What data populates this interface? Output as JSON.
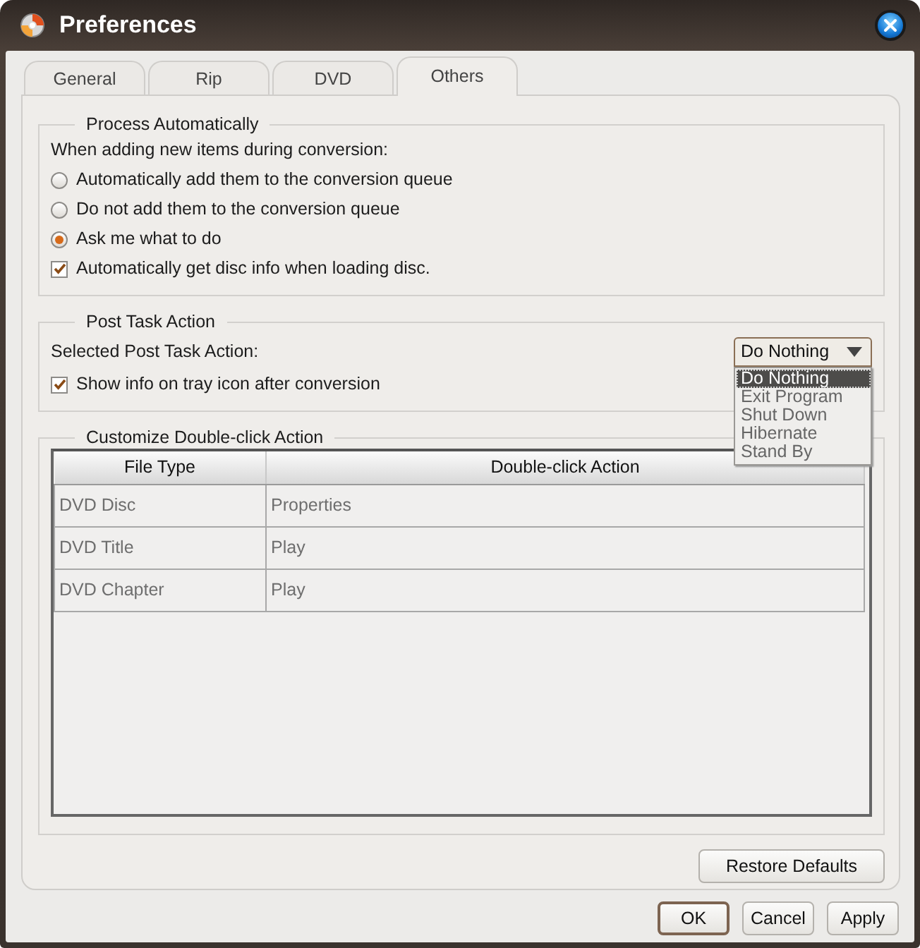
{
  "window": {
    "title": "Preferences"
  },
  "tabs": [
    {
      "label": "General",
      "selected": false
    },
    {
      "label": "Rip",
      "selected": false
    },
    {
      "label": "DVD",
      "selected": false
    },
    {
      "label": "Others",
      "selected": true
    }
  ],
  "process_automatically": {
    "title": "Process Automatically",
    "prompt": "When adding new items during conversion:",
    "options": [
      {
        "label": "Automatically add them to the conversion queue",
        "selected": false
      },
      {
        "label": "Do not add them to the conversion queue",
        "selected": false
      },
      {
        "label": "Ask me what to do",
        "selected": true
      }
    ],
    "checkbox": {
      "label": "Automatically get disc info when loading disc.",
      "checked": true
    }
  },
  "post_task_action": {
    "title": "Post Task Action",
    "label": "Selected Post Task Action:",
    "dropdown": {
      "value": "Do Nothing",
      "expanded": true,
      "options": [
        {
          "label": "Do Nothing",
          "selected": true
        },
        {
          "label": "Exit Program",
          "selected": false
        },
        {
          "label": "Shut Down",
          "selected": false
        },
        {
          "label": "Hibernate",
          "selected": false
        },
        {
          "label": "Stand By",
          "selected": false
        }
      ]
    },
    "checkbox": {
      "label": "Show info on tray icon after conversion",
      "checked": true
    }
  },
  "double_click_action": {
    "title": "Customize Double-click Action",
    "columns": [
      "File Type",
      "Double-click Action"
    ],
    "rows": [
      [
        "DVD Disc",
        "Properties"
      ],
      [
        "DVD Title",
        "Play"
      ],
      [
        "DVD Chapter",
        "Play"
      ]
    ]
  },
  "restore_defaults": "Restore Defaults",
  "buttons": [
    {
      "label": "OK",
      "default": true
    },
    {
      "label": "Cancel",
      "default": false
    },
    {
      "label": "Apply",
      "default": false
    }
  ]
}
